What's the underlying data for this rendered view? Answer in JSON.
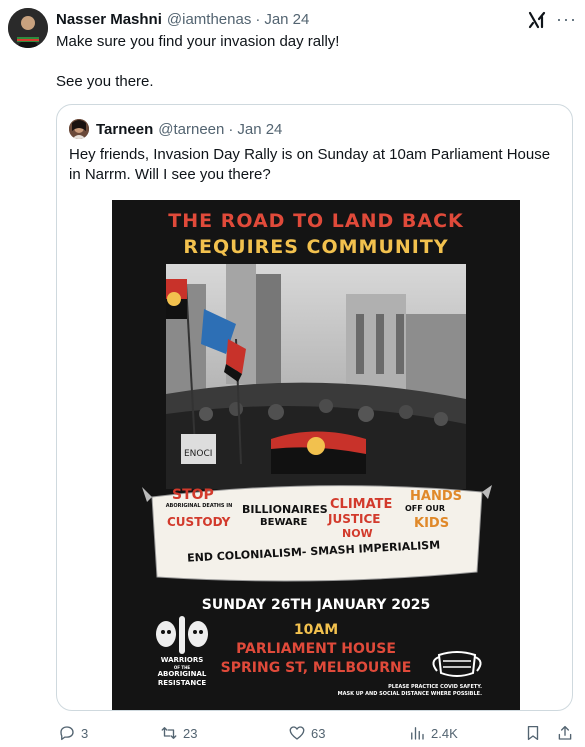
{
  "tweet": {
    "author_name": "Nasser Mashni",
    "author_handle": "@iamthenas",
    "separator": "·",
    "date": "Jan 24",
    "text_line1": "Make sure you find your invasion day rally!",
    "text_line2": "See you there."
  },
  "quote": {
    "author_name": "Tarneen",
    "author_handle": "@tarneen",
    "separator": "·",
    "date": "Jan 24",
    "text": "Hey friends, Invasion Day Rally is on Sunday at 10am Parliament House in Narrm. Will I see you there?"
  },
  "poster": {
    "title_line1": "THE ROAD TO LAND BACK",
    "title_line2": "REQUIRES COMMUNITY",
    "photo_sign": "ENOCI",
    "banner": {
      "stop": "STOP",
      "aboriginal_deaths": "ABORIGINAL DEATHS IN",
      "custody": "CUSTODY",
      "billionaires": "BILLIONAIRES",
      "beware": "BEWARE",
      "climate": "CLIMATE",
      "justice": "JUSTICE",
      "now": "NOW",
      "hands": "HANDS",
      "off_our": "OFF OUR",
      "kids": "KIDS",
      "slogan": "END COLONIALISM- SMASH IMPERIALISM"
    },
    "date": "SUNDAY 26TH JANUARY 2025",
    "time": "10AM",
    "venue_line1": "PARLIAMENT HOUSE",
    "venue_line2": "SPRING ST, MELBOURNE",
    "warriors_line1": "WARRIORS",
    "warriors_of": "OF THE",
    "warriors_line2": "ABORIGINAL",
    "warriors_line3": "RESISTANCE",
    "covid_line1": "PLEASE PRACTICE COVID SAFETY.",
    "covid_line2": "MASK UP AND SOCIAL DISTANCE WHERE POSSIBLE."
  },
  "actions": {
    "replies": "3",
    "reposts": "23",
    "likes": "63",
    "views": "2.4K"
  },
  "colors": {
    "text_primary": "#0f1419",
    "text_muted": "#536471",
    "border": "#cfd9de",
    "poster_red": "#e04a3a",
    "poster_yellow": "#f2c14e"
  }
}
